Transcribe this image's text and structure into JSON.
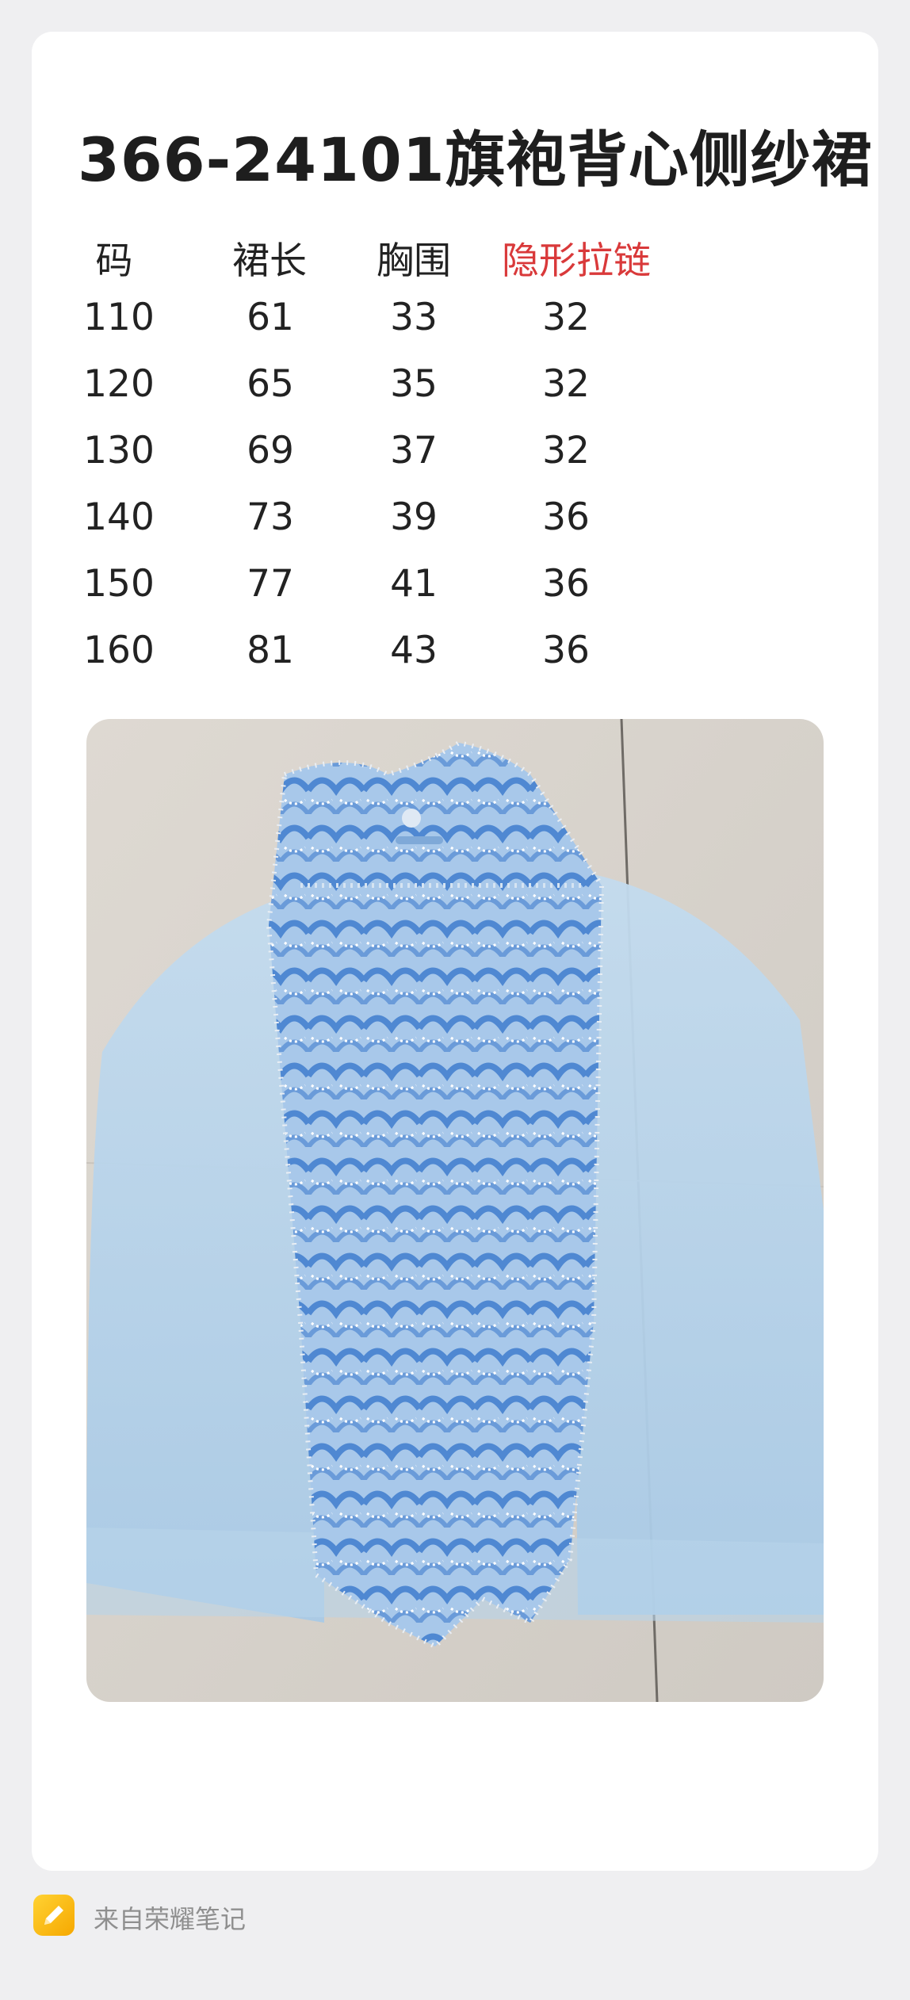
{
  "note": {
    "title": "366-24101旗袍背心侧纱裙",
    "table": {
      "headers": [
        "码",
        "裙长",
        "胸围",
        "隐形拉链"
      ],
      "rows": [
        [
          "110",
          "61",
          "33",
          "32"
        ],
        [
          "120",
          "65",
          "35",
          "32"
        ],
        [
          "130",
          "69",
          "37",
          "32"
        ],
        [
          "140",
          "73",
          "39",
          "36"
        ],
        [
          "150",
          "77",
          "41",
          "36"
        ],
        [
          "160",
          "81",
          "43",
          "36"
        ]
      ]
    },
    "photo": {
      "subject": "light-blue sleeveless qipao dress with tulle side panels and sequin lace",
      "colors": [
        "#b8d6ec",
        "#5b8fd0",
        "#d9d4cd"
      ]
    }
  },
  "footer": {
    "source_label": "来自荣耀笔记",
    "icon": "pencil-note-icon",
    "icon_color": "#f6b300"
  },
  "colors": {
    "background": "#efeff1",
    "card": "#ffffff",
    "accent_red": "#d9393a",
    "text": "#1e1e1e"
  }
}
